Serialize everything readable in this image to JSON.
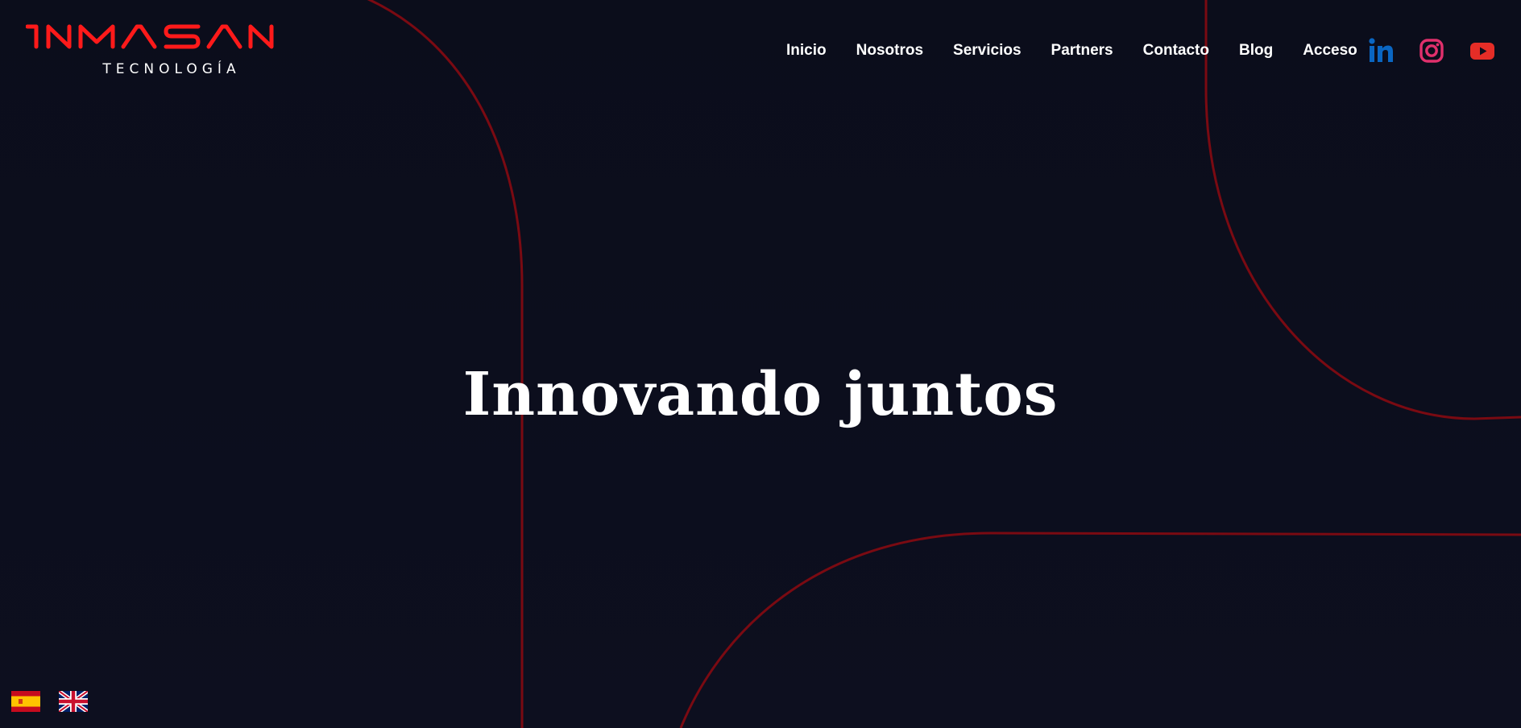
{
  "brand": {
    "name": "INMASAN",
    "tagline": "TECNOLOGÍA",
    "color": "#ff1a1a"
  },
  "nav": {
    "items": [
      {
        "label": "Inicio"
      },
      {
        "label": "Nosotros"
      },
      {
        "label": "Servicios"
      },
      {
        "label": "Partners"
      },
      {
        "label": "Contacto"
      },
      {
        "label": "Blog"
      },
      {
        "label": "Acceso"
      }
    ]
  },
  "social": [
    {
      "icon": "linkedin-icon",
      "color": "#0a66c2"
    },
    {
      "icon": "instagram-icon",
      "color": "#e1306c"
    },
    {
      "icon": "youtube-icon",
      "color": "#e52d27"
    }
  ],
  "hero": {
    "title": "Innovando juntos"
  },
  "languages": [
    {
      "code": "es",
      "icon": "spain-flag-icon"
    },
    {
      "code": "en",
      "icon": "uk-flag-icon"
    }
  ],
  "colors": {
    "background": "#0c0e1c",
    "accent_line": "#7a0a12"
  }
}
